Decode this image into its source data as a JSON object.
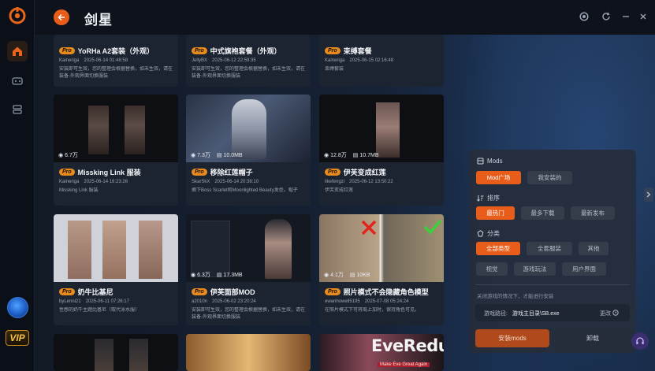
{
  "app": {
    "title": "剑星"
  },
  "titlebar_icons": [
    "record-icon",
    "refresh-icon",
    "minimize-icon",
    "close-icon"
  ],
  "sidebar": {
    "items": [
      {
        "icon": "home-icon",
        "active": true
      },
      {
        "icon": "gamepad-icon",
        "active": false
      },
      {
        "icon": "layers-icon",
        "active": false
      }
    ],
    "vip_label": "VIP"
  },
  "cards": [
    {
      "pro": "Pro",
      "name": "YoRHa A2套装（外观）",
      "author": "Kaineriga",
      "date": "2025-06-14 01:48:58",
      "desc": "安装即可生效，您的整理会根据替换，如未生效，请在装备-外观界面切换服装"
    },
    {
      "pro": "Pro",
      "name": "中式旗袍套餐（外观）",
      "author": "JellyBX",
      "date": "2025-06-12 22:59:35",
      "desc": "安装即可生效，您的整理会根据替换，如未生效，请在装备-外观界面切换服装"
    },
    {
      "pro": "Pro",
      "name": "束缚套餐",
      "author": "Kaineriga",
      "date": "2025-06-15 02:16:48",
      "desc": "束缚套装"
    },
    {
      "pro": "Pro",
      "name": "Missking Link 服装",
      "author": "Kaineriga",
      "date": "2025-06-14 16:23:26",
      "desc": "Missking Link 服装",
      "views": "6.7万",
      "size": ""
    },
    {
      "pro": "Pro",
      "name": "移除红莲帽子",
      "author": "SkarSkX",
      "date": "2025-06-14 20:38:10",
      "desc": "摘下Boss Scarlet和Moonlighted Beauty发型。帽子",
      "views": "7.3万",
      "size": "10.0MB"
    },
    {
      "pro": "Pro",
      "name": "伊芙变成红莲",
      "author": "likefengzi",
      "date": "2025-06-12 13:50:22",
      "desc": "伊芙变成红莲",
      "views": "12.8万",
      "size": "10.7MB"
    },
    {
      "pro": "Pro",
      "name": "奶牛比基尼",
      "author": "byLenni21",
      "date": "2025-06-11 07:26:17",
      "desc": "性感的奶牛主题比基尼（取代泳水服）",
      "views": "",
      "size": ""
    },
    {
      "pro": "Pro",
      "name": "伊芙面部MOD",
      "author": "a2010n",
      "date": "2025-06-02 23:20:24",
      "desc": "安装即可生效，您的整理会根据替换，如未生效，请在装备-外观界面切换服装",
      "views": "6.3万",
      "size": "17.3MB"
    },
    {
      "pro": "Pro",
      "name": "照片模式不会隐藏角色模型",
      "author": "ewanhowell5195",
      "date": "2025-07-08 05:24:24",
      "desc": "在照片模式下可将局上加时，保持角色可见。",
      "views": "4.1万",
      "size": "10KB"
    }
  ],
  "bottom_cards_logo": {
    "title": "EveRedux",
    "tagline": "Make Eve Great Again"
  },
  "filter_panel": {
    "mods_title": "Mods",
    "mods_tabs": [
      {
        "label": "Mod广场",
        "active": true
      },
      {
        "label": "我安装的",
        "active": false
      }
    ],
    "sort_title": "排序",
    "sort_tabs": [
      {
        "label": "最热门",
        "active": true
      },
      {
        "label": "最多下载",
        "active": false
      },
      {
        "label": "最新发布",
        "active": false
      }
    ],
    "cat_title": "分类",
    "cat_tabs": [
      {
        "label": "全部类型",
        "active": true
      },
      {
        "label": "全套服装",
        "active": false
      },
      {
        "label": "其他",
        "active": false
      },
      {
        "label": "视觉",
        "active": false
      },
      {
        "label": "游戏玩法",
        "active": false
      },
      {
        "label": "用户界面",
        "active": false
      }
    ],
    "hint": "关闭游戏的情况下，才能进行安装",
    "path_label": "游戏路径:",
    "path_value": "游戏主目录\\SB.exe",
    "change_label": "更改",
    "install_label": "安装mods",
    "uninstall_label": "卸载"
  },
  "colors": {
    "accent": "#e85d1a",
    "pro_badge": "#e88b1f",
    "vip": "#f5c046"
  }
}
